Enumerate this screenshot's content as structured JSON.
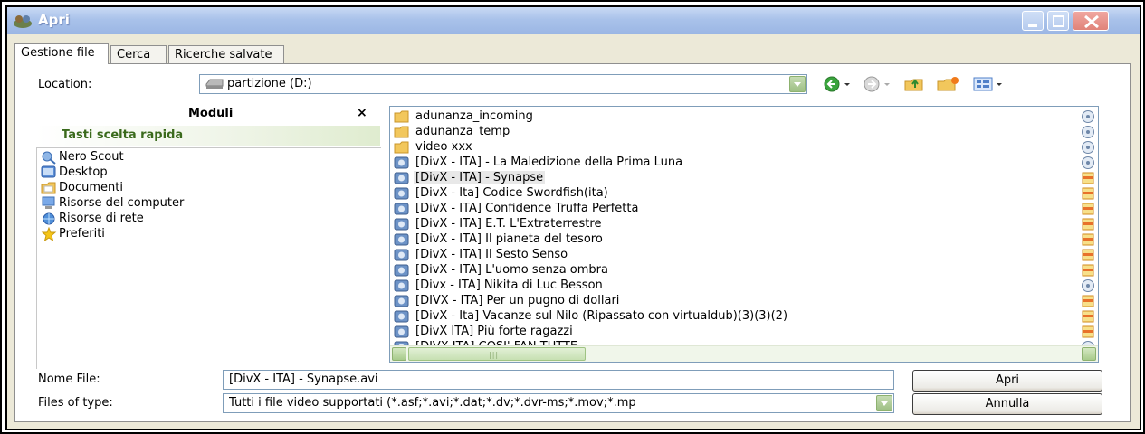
{
  "window": {
    "title": "Apri"
  },
  "tabs": [
    {
      "label": "Gestione file"
    },
    {
      "label": "Cerca"
    },
    {
      "label": "Ricerche salvate"
    }
  ],
  "location": {
    "label": "Location:",
    "value": "partizione (D:)"
  },
  "toolbar_icons": [
    "back-icon",
    "forward-icon",
    "up-folder-icon",
    "new-folder-icon",
    "view-menu-icon"
  ],
  "sidebar": {
    "title": "Moduli",
    "close_label": "×",
    "section_header": "Tasti scelta rapida",
    "items": [
      {
        "label": "Nero Scout",
        "icon": "nero-scout-icon"
      },
      {
        "label": "Desktop",
        "icon": "desktop-icon"
      },
      {
        "label": "Documenti",
        "icon": "documents-icon"
      },
      {
        "label": "Risorse del computer",
        "icon": "computer-icon"
      },
      {
        "label": "Risorse di rete",
        "icon": "network-icon"
      },
      {
        "label": "Preferiti",
        "icon": "star-icon"
      }
    ]
  },
  "files": [
    {
      "name": "adunanza_incoming",
      "type": "folder"
    },
    {
      "name": "adunanza_temp",
      "type": "folder"
    },
    {
      "name": "video xxx",
      "type": "folder"
    },
    {
      "name": "[DivX - ITA] - La Maledizione della Prima Luna",
      "type": "video"
    },
    {
      "name": "[DivX - ITA] - Synapse",
      "type": "video",
      "selected": true
    },
    {
      "name": "[DivX - Ita] Codice Swordfish(ita)",
      "type": "video"
    },
    {
      "name": "[DivX - ITA] Confidence Truffa Perfetta",
      "type": "video"
    },
    {
      "name": "[DivX - ITA] E.T. L'Extraterrestre",
      "type": "video"
    },
    {
      "name": "[DivX - ITA] Il pianeta del tesoro",
      "type": "video"
    },
    {
      "name": "[DivX - ITA] Il Sesto Senso",
      "type": "video"
    },
    {
      "name": "[DivX - ITA] L'uomo senza ombra",
      "type": "video"
    },
    {
      "name": "[Divx - ITA] Nikita di Luc Besson",
      "type": "video"
    },
    {
      "name": "[DIVX - ITA] Per un pugno di dollari",
      "type": "video"
    },
    {
      "name": "[DivX - Ita] Vacanze  sul Nilo (Ripassato con virtualdub)(3)(3)(2)",
      "type": "video"
    },
    {
      "name": "[DivX ITA] Più forte ragazzi",
      "type": "video"
    },
    {
      "name": "[DIVX-ITA] COSI' FAN TUTTE",
      "type": "video"
    }
  ],
  "filename": {
    "label": "Nome File:",
    "value": "[DivX - ITA] - Synapse.avi"
  },
  "filetype": {
    "label": "Files of type:",
    "value": "Tutti i file video supportati (*.asf;*.avi;*.dat;*.dv;*.dvr-ms;*.mov;*.mp"
  },
  "buttons": {
    "open": "Apri",
    "cancel": "Annulla"
  },
  "colors": {
    "titlebar": "#a9c2ea",
    "accent_green": "#9dbf83",
    "close_button": "#e08379"
  }
}
